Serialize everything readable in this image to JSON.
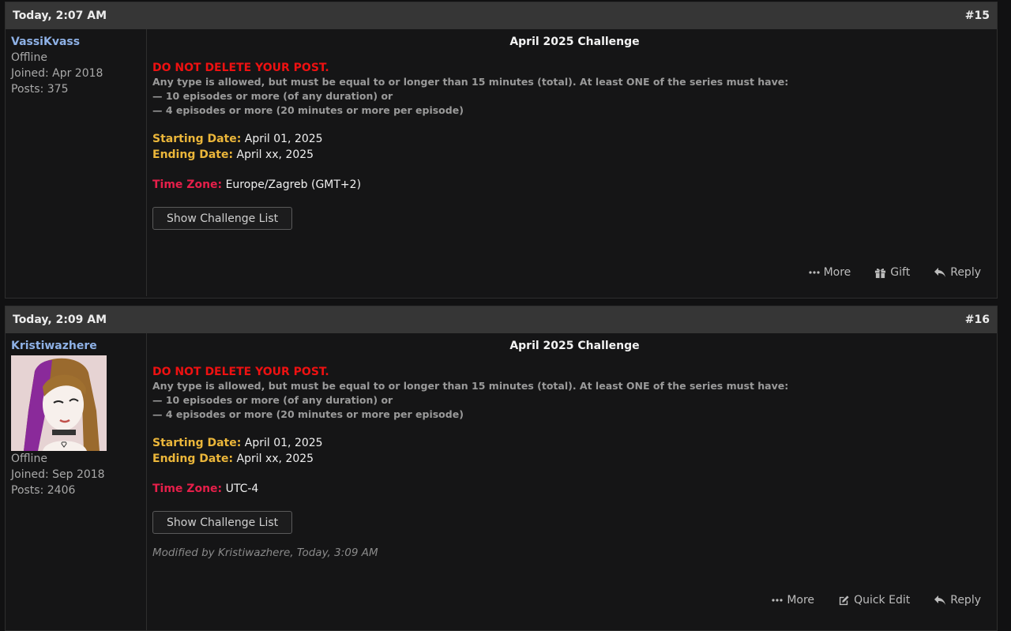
{
  "posts": [
    {
      "time": "Today, 2:07 AM",
      "number": "#15",
      "user": {
        "name": "VassiKvass",
        "status": "Offline",
        "joined": "Joined: Apr 2018",
        "posts": "Posts: 375",
        "has_avatar": false
      },
      "title": "April 2025 Challenge",
      "warning": "DO NOT DELETE YOUR POST.",
      "rules": "Any type is allowed, but must be equal to or longer than 15 minutes (total). At least ONE of the series must have:",
      "rule_1": "— 10 episodes or more (of any duration) or",
      "rule_2": "— 4 episodes or more (20 minutes or more per episode)",
      "start_label": "Starting Date:",
      "start_value": " April 01, 2025",
      "end_label": "Ending Date:",
      "end_value": " April xx, 2025",
      "tz_label": "Time Zone:",
      "tz_value": " Europe/Zagreb (GMT+2)",
      "button": "Show Challenge List",
      "actions": [
        "More",
        "Gift",
        "Reply"
      ]
    },
    {
      "time": "Today, 2:09 AM",
      "number": "#16",
      "user": {
        "name": "Kristiwazhere",
        "status": "Offline",
        "joined": "Joined: Sep 2018",
        "posts": "Posts: 2406",
        "has_avatar": true
      },
      "title": "April 2025 Challenge",
      "warning": "DO NOT DELETE YOUR POST.",
      "rules": "Any type is allowed, but must be equal to or longer than 15 minutes (total). At least ONE of the series must have:",
      "rule_1": "— 10 episodes or more (of any duration) or",
      "rule_2": "— 4 episodes or more (20 minutes or more per episode)",
      "start_label": "Starting Date:",
      "start_value": " April 01, 2025",
      "end_label": "Ending Date:",
      "end_value": " April xx, 2025",
      "tz_label": "Time Zone:",
      "tz_value": " UTC-4",
      "button": "Show Challenge List",
      "modified": "Modified by Kristiwazhere, Today, 3:09 AM",
      "actions": [
        "More",
        "Quick Edit",
        "Reply"
      ]
    }
  ]
}
